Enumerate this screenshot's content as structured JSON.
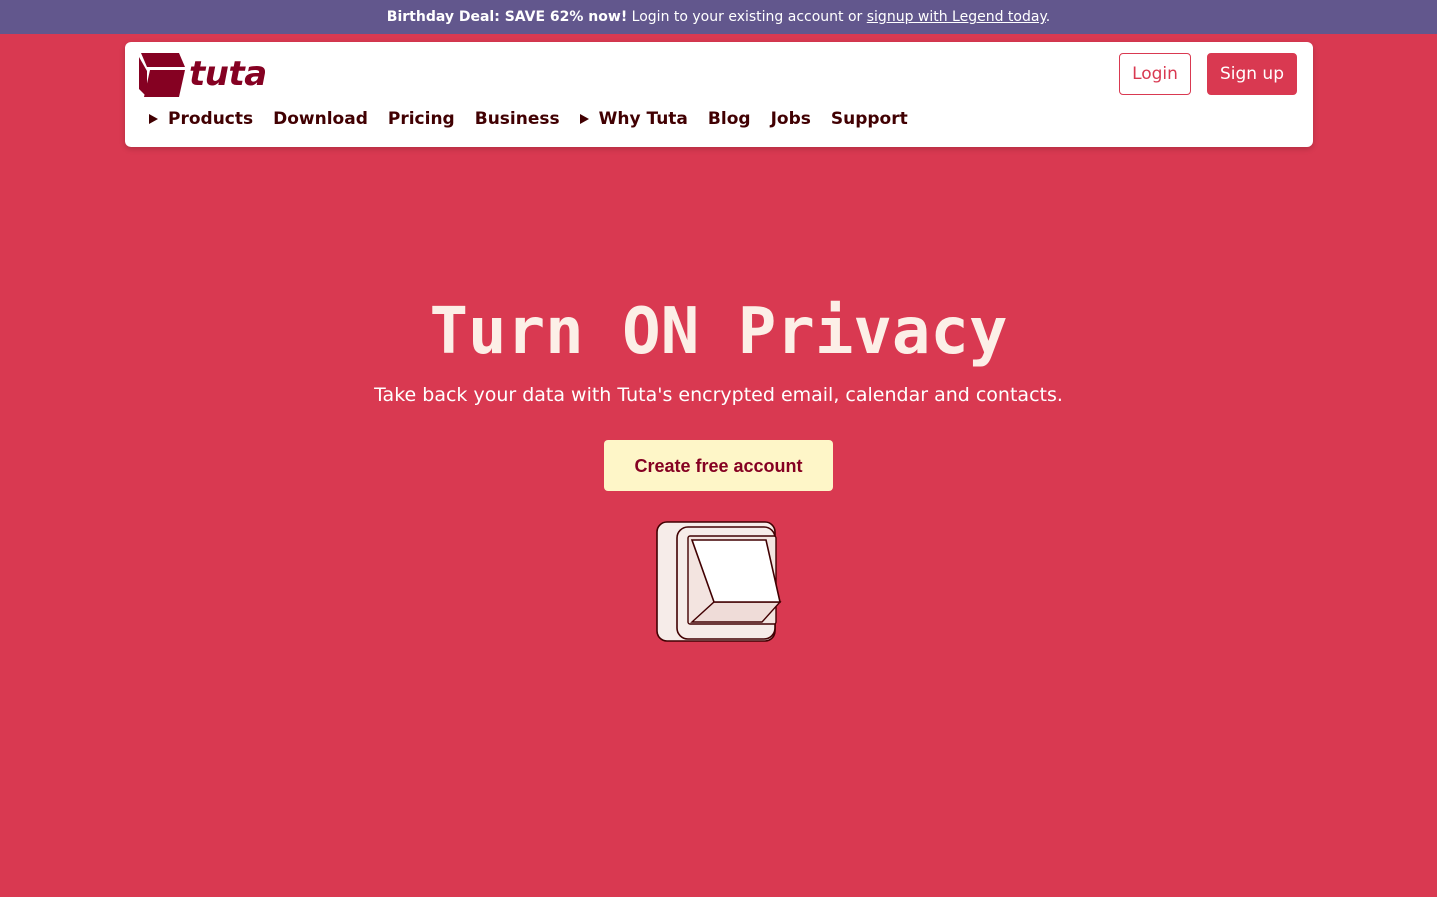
{
  "promo": {
    "deal": "Birthday Deal: SAVE 62% now!",
    "text": " Login to your existing account or ",
    "link": "signup with Legend today",
    "end": "."
  },
  "header": {
    "logo_icon": "tuta-logo-icon",
    "logo_text": "tuta",
    "login_label": "Login",
    "signup_label": "Sign up",
    "nav": [
      {
        "label": "Products",
        "dropdown": true
      },
      {
        "label": "Download",
        "dropdown": false
      },
      {
        "label": "Pricing",
        "dropdown": false
      },
      {
        "label": "Business",
        "dropdown": false
      },
      {
        "label": "Why Tuta",
        "dropdown": true
      },
      {
        "label": "Blog",
        "dropdown": false
      },
      {
        "label": "Jobs",
        "dropdown": false
      },
      {
        "label": "Support",
        "dropdown": false
      }
    ]
  },
  "hero": {
    "title": "Turn ON Privacy",
    "subtitle": "Take back your data with Tuta's encrypted email, calendar and contacts.",
    "cta_label": "Create free account",
    "illustration": "light-switch-illustration"
  },
  "colors": {
    "brand_red": "#d93951",
    "banner_purple": "#62578d",
    "dark_text": "#410002",
    "logo_red": "#850122",
    "cta_bg": "#fef6c8",
    "title_color": "#fcefe7"
  }
}
